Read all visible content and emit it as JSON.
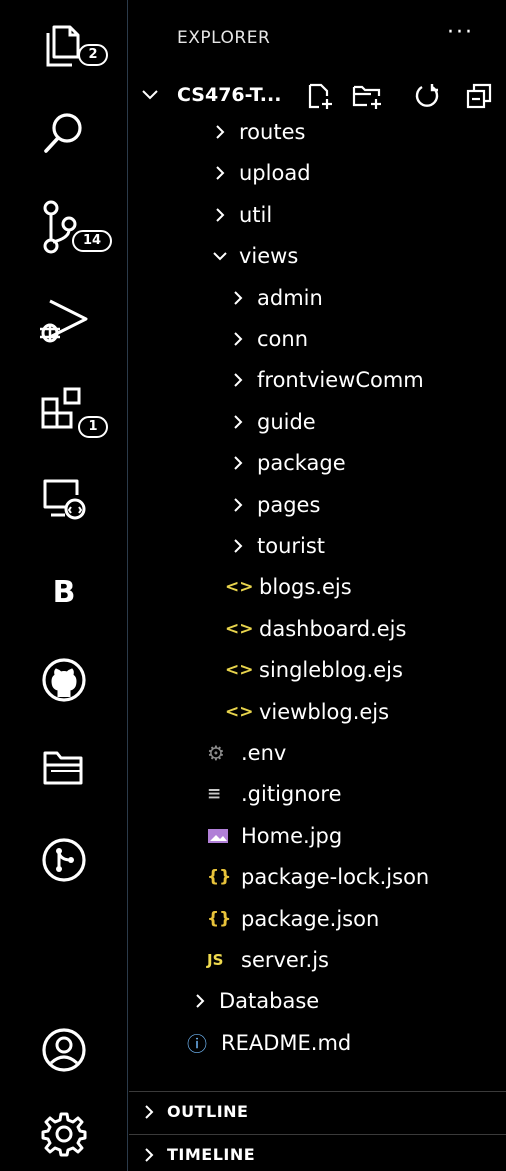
{
  "activity_bar": {
    "explorer": {
      "icon": "explorer-files-icon",
      "badge": "2"
    },
    "search": {
      "icon": "search-icon"
    },
    "source_control": {
      "icon": "source-control-icon",
      "badge": "14"
    },
    "run_debug": {
      "icon": "run-debug-icon"
    },
    "extensions": {
      "icon": "extensions-icon",
      "badge": "1"
    },
    "remote_explorer": {
      "icon": "remote-explorer-icon"
    },
    "bootstrap": {
      "icon": "bootstrap-icon",
      "label": "B"
    },
    "github": {
      "icon": "github-icon"
    },
    "project_manager": {
      "icon": "folders-icon"
    },
    "gitlens": {
      "icon": "gitlens-icon"
    },
    "accounts": {
      "icon": "account-icon"
    },
    "manage": {
      "icon": "gear-icon"
    }
  },
  "explorer": {
    "title": "EXPLORER",
    "more": "···",
    "root": "CS476-T...",
    "toolbar": [
      "new-file-icon",
      "new-folder-icon",
      "refresh-icon",
      "collapse-all-icon"
    ],
    "tree": [
      {
        "label": "routes",
        "kind": "folder",
        "expanded": false,
        "depth": 1
      },
      {
        "label": "upload",
        "kind": "folder",
        "expanded": false,
        "depth": 1
      },
      {
        "label": "util",
        "kind": "folder",
        "expanded": false,
        "depth": 1
      },
      {
        "label": "views",
        "kind": "folder",
        "expanded": true,
        "depth": 1
      },
      {
        "label": "admin",
        "kind": "folder",
        "expanded": false,
        "depth": 2
      },
      {
        "label": "conn",
        "kind": "folder",
        "expanded": false,
        "depth": 2
      },
      {
        "label": "frontviewComm",
        "kind": "folder",
        "expanded": false,
        "depth": 2
      },
      {
        "label": "guide",
        "kind": "folder",
        "expanded": false,
        "depth": 2
      },
      {
        "label": "package",
        "kind": "folder",
        "expanded": false,
        "depth": 2
      },
      {
        "label": "pages",
        "kind": "folder",
        "expanded": false,
        "depth": 2
      },
      {
        "label": "tourist",
        "kind": "folder",
        "expanded": false,
        "depth": 2
      },
      {
        "label": "blogs.ejs",
        "kind": "ejs",
        "depth": 2
      },
      {
        "label": "dashboard.ejs",
        "kind": "ejs",
        "depth": 2
      },
      {
        "label": "singleblog.ejs",
        "kind": "ejs",
        "depth": 2
      },
      {
        "label": "viewblog.ejs",
        "kind": "ejs",
        "depth": 2
      },
      {
        "label": ".env",
        "kind": "env",
        "depth": 1
      },
      {
        "label": ".gitignore",
        "kind": "gitignore",
        "depth": 1
      },
      {
        "label": "Home.jpg",
        "kind": "image",
        "depth": 1
      },
      {
        "label": "package-lock.json",
        "kind": "json",
        "depth": 1
      },
      {
        "label": "package.json",
        "kind": "json",
        "depth": 1
      },
      {
        "label": "server.js",
        "kind": "js",
        "depth": 1
      },
      {
        "label": "Database",
        "kind": "folder",
        "expanded": false,
        "depth": 0
      },
      {
        "label": "README.md",
        "kind": "info",
        "depth": 0
      }
    ],
    "file_icon_glyphs": {
      "ejs": "<>",
      "json": "{}",
      "js": "JS",
      "info": "ⓘ",
      "gitignore": "≡",
      "env": "⚙"
    },
    "colors": {
      "ejs": "#e8d44d",
      "json": "#e8c33a",
      "js": "#f0db4f",
      "image": "#b180d7",
      "env": "#8c8c8c",
      "info": "#75beff"
    }
  },
  "sections": {
    "outline": "OUTLINE",
    "timeline": "TIMELINE"
  }
}
